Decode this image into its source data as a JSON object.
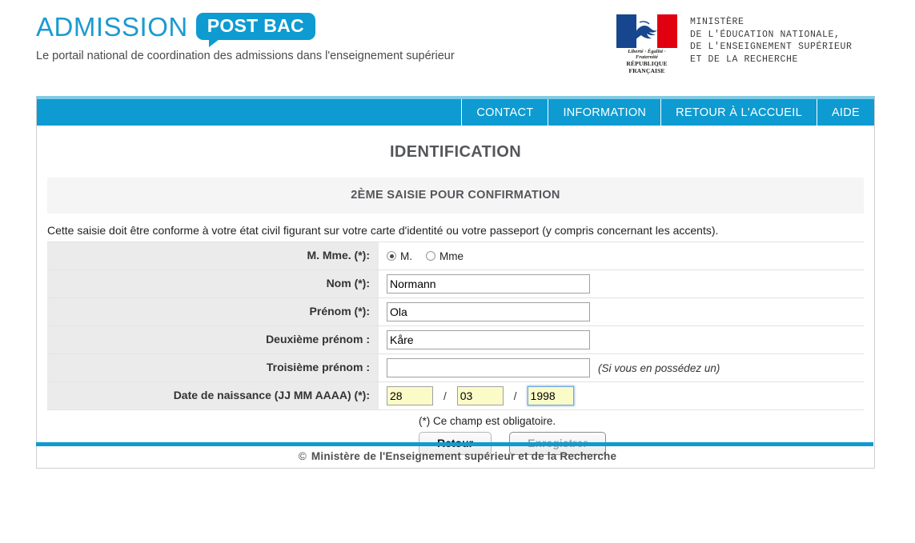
{
  "header": {
    "brand_main": "ADMISSION",
    "brand_badge": "POST BAC",
    "tagline": "Le portail national de coordination des admissions dans l'enseignement supérieur",
    "ministry_logo": {
      "liberty_motto": "Liberté · Égalité · Fraternité",
      "republic": "RÉPUBLIQUE FRANÇAISE"
    },
    "ministry_lines": "MINISTÈRE\nDE L'ÉDUCATION NATIONALE,\nDE L'ENSEIGNEMENT SUPÉRIEUR\nET DE LA RECHERCHE"
  },
  "nav": {
    "items": [
      {
        "label": "CONTACT"
      },
      {
        "label": "INFORMATION"
      },
      {
        "label": "RETOUR À L'ACCUEIL"
      },
      {
        "label": "AIDE"
      }
    ]
  },
  "main": {
    "page_title": "IDENTIFICATION",
    "section_banner": "2ÈME SAISIE POUR CONFIRMATION",
    "intro": "Cette saisie doit être conforme à votre état civil figurant sur votre carte d'identité ou votre passeport (y compris concernant les accents).",
    "required_note": "(*) Ce champ est obligatoire."
  },
  "form": {
    "civility": {
      "label": "M. Mme. (*):",
      "options": [
        {
          "label": "M.",
          "selected": true
        },
        {
          "label": "Mme",
          "selected": false
        }
      ]
    },
    "last_name": {
      "label": "Nom (*):",
      "value": "Normann",
      "placeholder": ""
    },
    "first_name": {
      "label": "Prénom (*):",
      "value": "Ola",
      "placeholder": ""
    },
    "second_name": {
      "label": "Deuxième prénom :",
      "value": "Kåre",
      "placeholder": ""
    },
    "third_name": {
      "label": "Troisième prénom :",
      "value": "",
      "placeholder": "",
      "hint": "(Si vous en possédez un)"
    },
    "birth_date": {
      "label": "Date de naissance (JJ MM AAAA) (*):",
      "day": "28",
      "month": "03",
      "year": "1998",
      "separator": "/"
    }
  },
  "buttons": {
    "back": "Retour",
    "save": "Enregistrer"
  },
  "footer": {
    "copyright_symbol": "©",
    "text": "Ministère de l'Enseignement supérieur et de la Recherche"
  },
  "colors": {
    "brand_blue": "#0d9bd1",
    "brand_blue_light": "#7fcbe4",
    "label_bg": "#ebebeb",
    "banner_bg": "#f5f5f5",
    "autofill_yellow": "#fbfbc8",
    "flag_blue": "#16478e",
    "flag_red": "#e1000f"
  }
}
